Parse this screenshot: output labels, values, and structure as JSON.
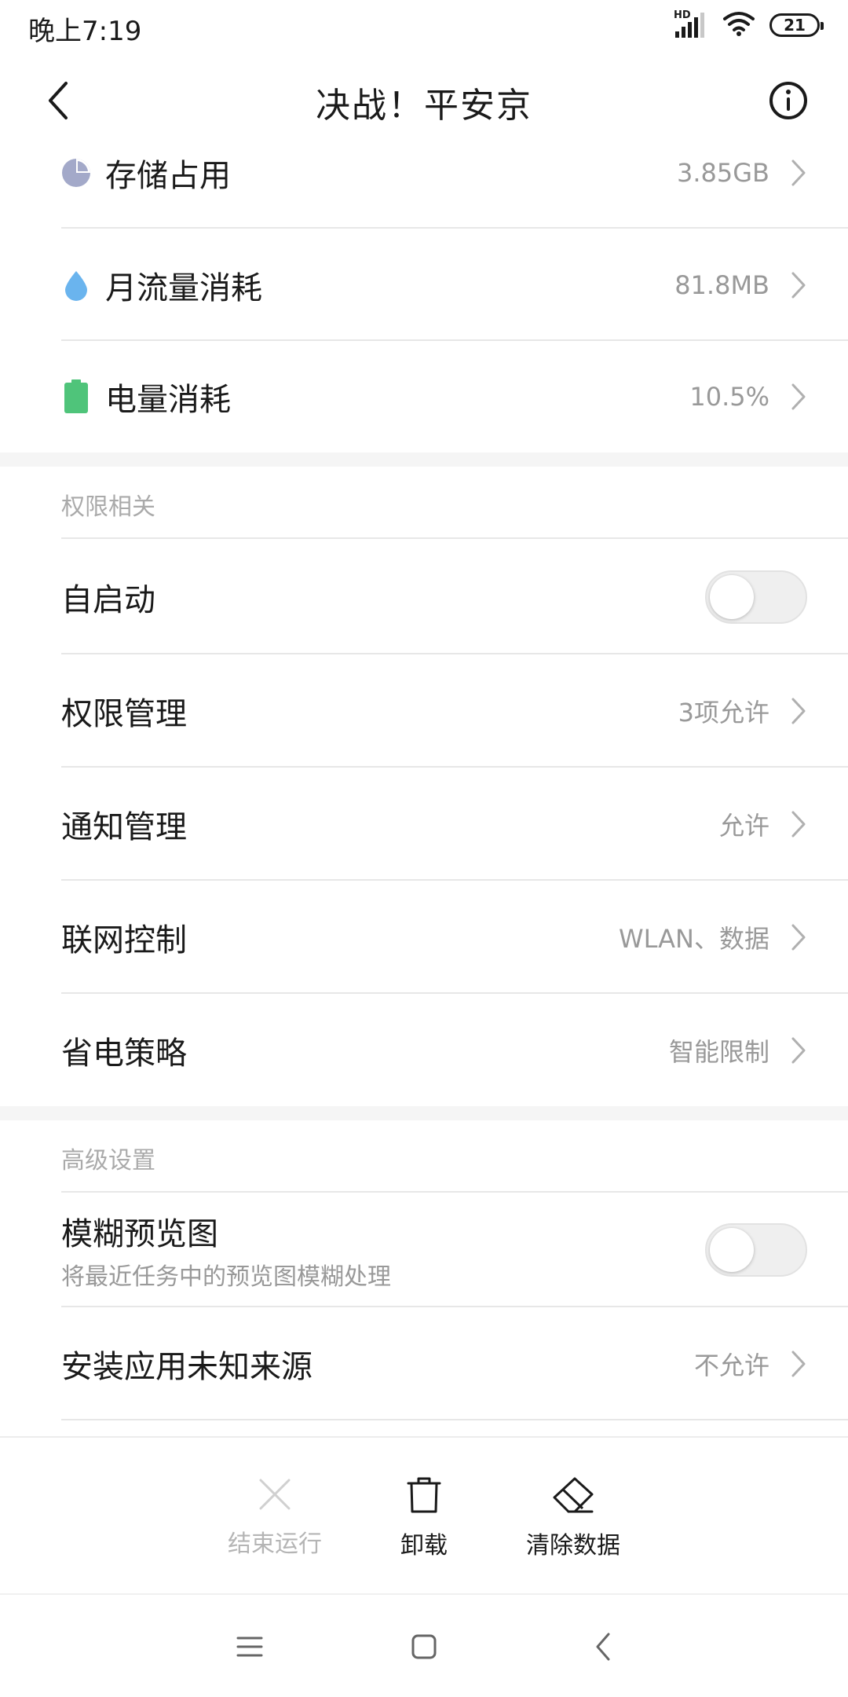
{
  "status_bar": {
    "time": "晚上7:19",
    "hd_label": "HD",
    "battery_level": "21"
  },
  "header": {
    "title": "决战！平安京"
  },
  "usage": [
    {
      "label": "存储占用",
      "value": "3.85GB",
      "icon": "pie-chart-icon",
      "icon_color": "#a3a9c9"
    },
    {
      "label": "月流量消耗",
      "value": "81.8MB",
      "icon": "water-drop-icon",
      "icon_color": "#6ab4ee"
    },
    {
      "label": "电量消耗",
      "value": "10.5%",
      "icon": "battery-icon",
      "icon_color": "#4fc47a"
    }
  ],
  "permissions": {
    "section_title": "权限相关",
    "autostart": {
      "label": "自启动",
      "enabled": false
    },
    "items": [
      {
        "label": "权限管理",
        "value": "3项允许"
      },
      {
        "label": "通知管理",
        "value": "允许"
      },
      {
        "label": "联网控制",
        "value": "WLAN、数据"
      },
      {
        "label": "省电策略",
        "value": "智能限制"
      }
    ]
  },
  "advanced": {
    "section_title": "高级设置",
    "blur_preview": {
      "label": "模糊预览图",
      "sublabel": "将最近任务中的预览图模糊处理",
      "enabled": false
    },
    "unknown_sources": {
      "label": "安装应用未知来源",
      "value": "不允许"
    }
  },
  "actions": {
    "force_stop": "结束运行",
    "uninstall": "卸载",
    "clear_data": "清除数据"
  },
  "colors": {
    "disabled": "#b5b5b5",
    "secondary_text": "#999999",
    "section_text": "#aaaaaa"
  }
}
